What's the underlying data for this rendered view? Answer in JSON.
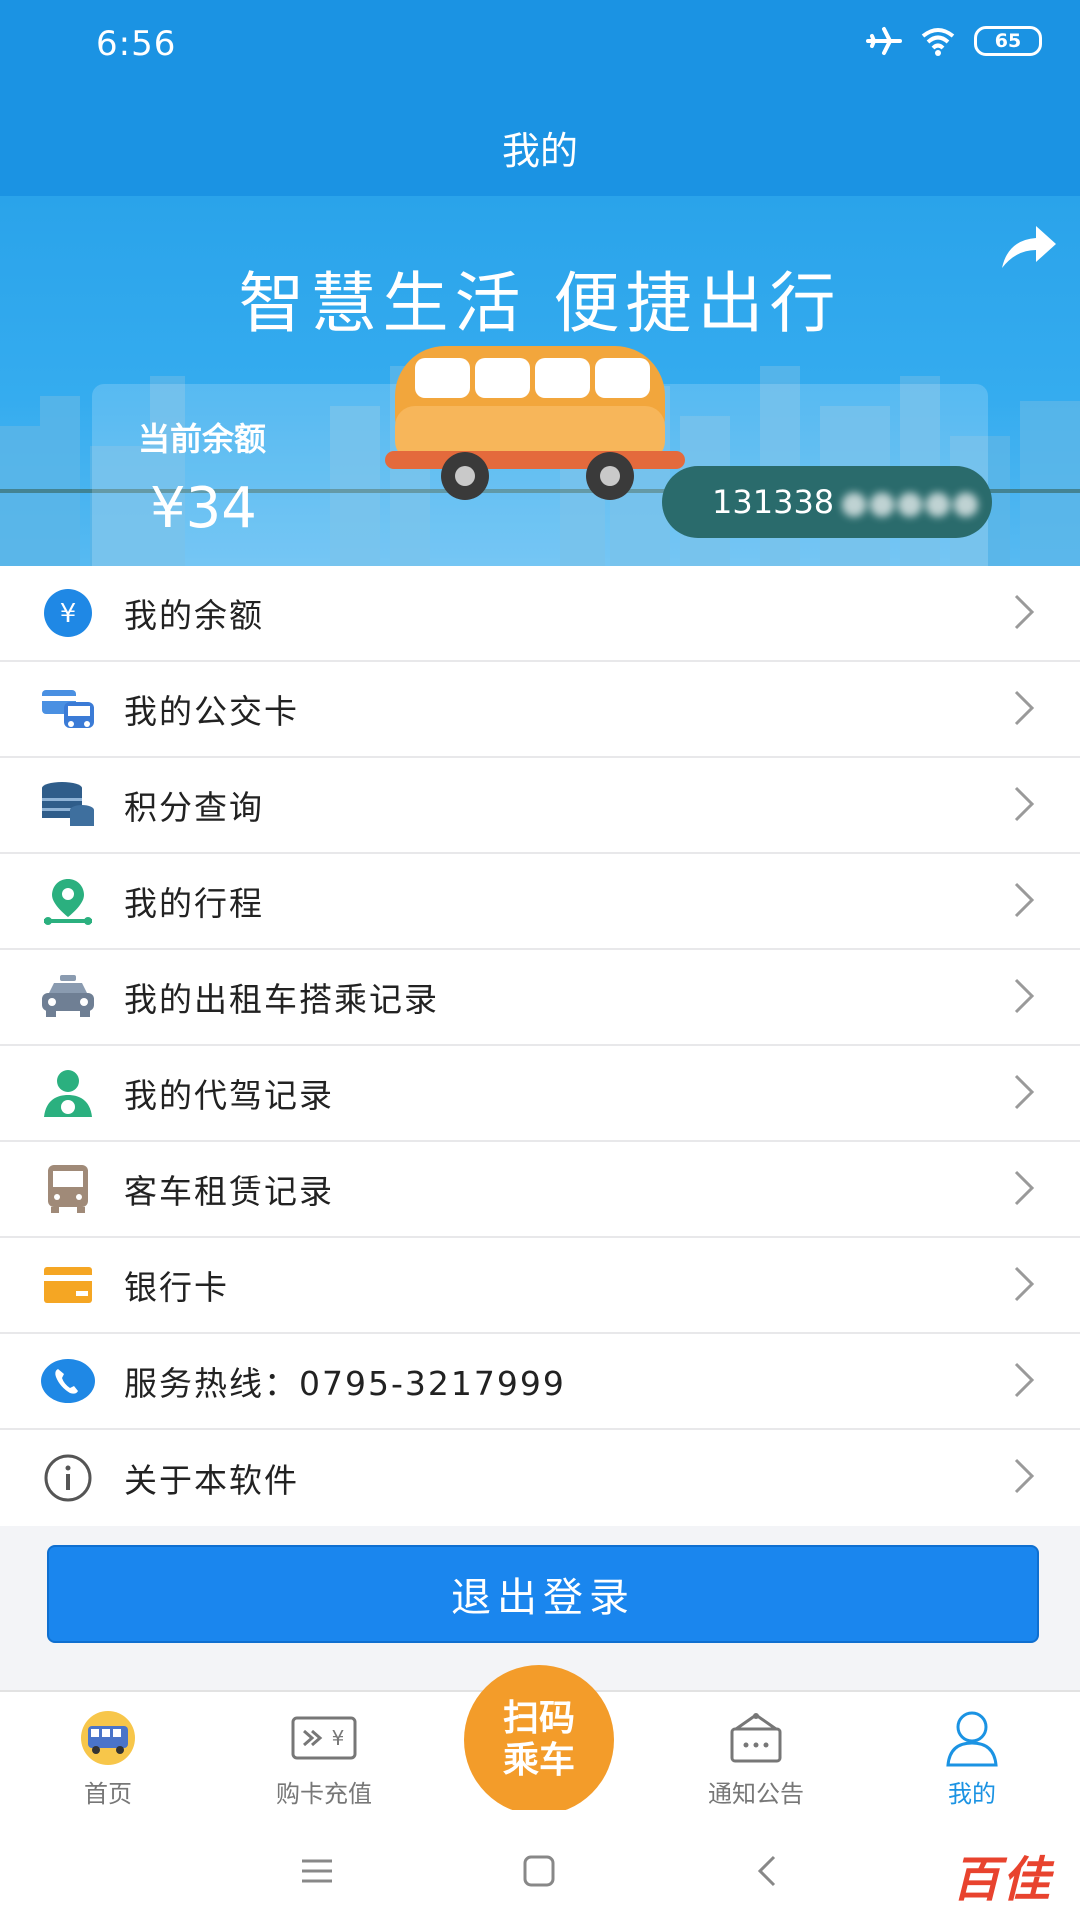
{
  "status_bar": {
    "time": "6:56",
    "battery": "65"
  },
  "header": {
    "title": "我的"
  },
  "banner": {
    "slogan": "智慧生活  便捷出行",
    "balance_label": "当前余额",
    "balance_value": "¥34",
    "phone": "131338"
  },
  "menu": [
    {
      "label": "我的余额",
      "icon": "yen-coin-icon"
    },
    {
      "label": "我的公交卡",
      "icon": "bus-card-icon"
    },
    {
      "label": "积分查询",
      "icon": "coin-stack-icon"
    },
    {
      "label": "我的行程",
      "icon": "route-pin-icon"
    },
    {
      "label": "我的出租车搭乘记录",
      "icon": "taxi-icon"
    },
    {
      "label": "我的代驾记录",
      "icon": "driver-icon"
    },
    {
      "label": "客车租赁记录",
      "icon": "coach-icon"
    },
    {
      "label": "银行卡",
      "icon": "bank-card-icon"
    },
    {
      "label": "服务热线：0795-3217999",
      "icon": "phone-icon"
    },
    {
      "label": "关于本软件",
      "icon": "info-icon"
    }
  ],
  "logout_label": "退出登录",
  "bottom_nav": {
    "home": "首页",
    "recharge": "购卡充值",
    "scan_line1": "扫码",
    "scan_line2": "乘车",
    "notice": "通知公告",
    "mine": "我的"
  },
  "watermark": "百佳",
  "colors": {
    "primary": "#1b93e3",
    "button": "#1a86ee",
    "scan": "#f39c2a",
    "active_tab": "#1b93e3"
  }
}
